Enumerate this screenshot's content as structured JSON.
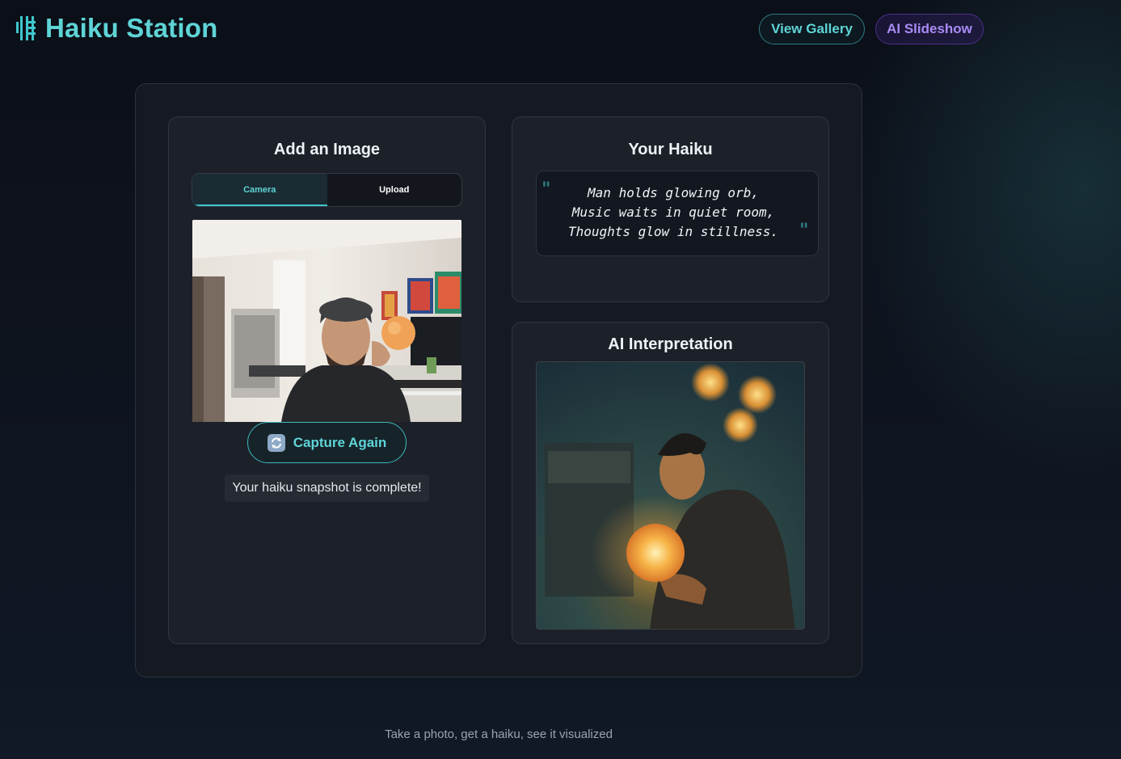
{
  "app": {
    "title": "Haiku Station",
    "logo_icon": "haiku-glyph-icon"
  },
  "nav": {
    "gallery_label": "View Gallery",
    "slideshow_label": "AI Slideshow"
  },
  "add_image": {
    "title": "Add an Image",
    "tabs": [
      {
        "label": "Camera",
        "active": true
      },
      {
        "label": "Upload",
        "active": false
      }
    ],
    "capture_label": "Capture Again",
    "capture_icon": "refresh-icon",
    "status_text": "Your haiku snapshot is complete!"
  },
  "haiku": {
    "title": "Your Haiku",
    "open_quote": "\"",
    "close_quote": "\"",
    "lines": [
      "Man holds glowing orb,",
      "Music waits in quiet room,",
      "Thoughts glow in stillness."
    ]
  },
  "ai": {
    "title": "AI Interpretation"
  },
  "footer": {
    "text": "Take a photo, get a haiku, see it visualized"
  },
  "colors": {
    "accent_teal": "#5fd4d6",
    "accent_purple": "#a98bf5",
    "background": "#0b0f18"
  }
}
